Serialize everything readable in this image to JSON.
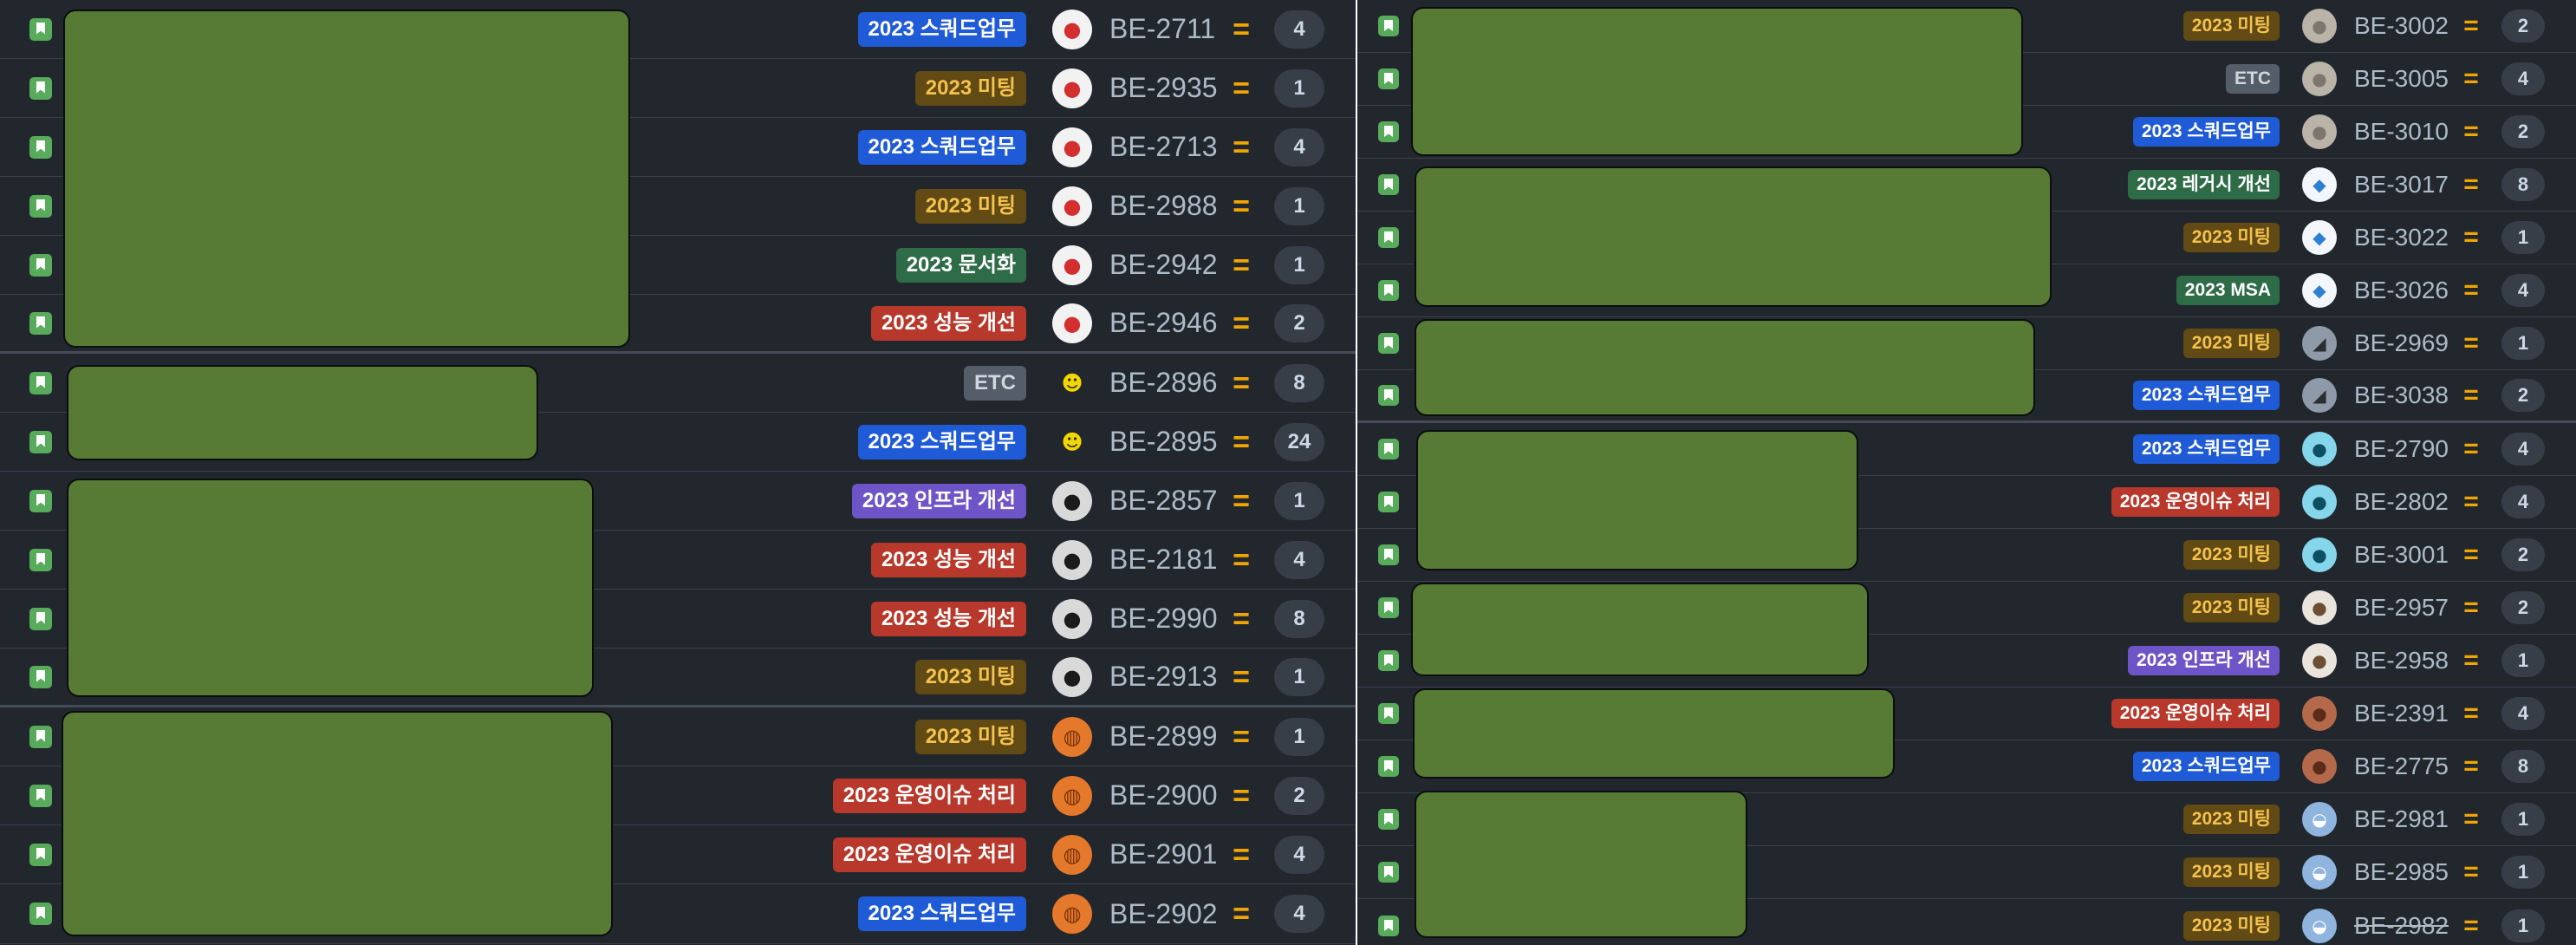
{
  "labels": {
    "squad": {
      "text": "2023 스쿼드업무",
      "bg": "#1f5bd6",
      "fg": "#ffffff"
    },
    "meeting": {
      "text": "2023 미팅",
      "bg": "#614a14",
      "fg": "#f5c24d"
    },
    "docs": {
      "text": "2023 문서화",
      "bg": "#2e6b47",
      "fg": "#ffffff"
    },
    "perf": {
      "text": "2023 성능 개선",
      "bg": "#b8382b",
      "fg": "#ffffff"
    },
    "etc": {
      "text": "ETC",
      "bg": "#545d68",
      "fg": "#d0d7de"
    },
    "infra": {
      "text": "2023 인프라 개선",
      "bg": "#6e55c7",
      "fg": "#ffffff"
    },
    "ops": {
      "text": "2023 운영이슈 처리",
      "bg": "#b8382b",
      "fg": "#ffffff"
    },
    "legacy": {
      "text": "2023 레거시 개선",
      "bg": "#2e6b47",
      "fg": "#ffffff"
    },
    "msa": {
      "text": "2023 MSA",
      "bg": "#2e6b47",
      "fg": "#ffffff"
    }
  },
  "avatars": {
    "snoopy": {
      "icon": "snoopy-avatar-icon",
      "glyph": "●",
      "bg": "#f2f2f2",
      "fg": "#d32f2f"
    },
    "frog": {
      "icon": "frog-avatar-icon",
      "glyph": "☻",
      "bg": "#22272e",
      "fg": "#f2d600"
    },
    "person": {
      "icon": "person-avatar-icon",
      "glyph": "●",
      "bg": "#d9d9d9",
      "fg": "#1b1b1b"
    },
    "ball": {
      "icon": "basketball-avatar-icon",
      "glyph": "◍",
      "bg": "#e4792b",
      "fg": "#7a3206"
    },
    "cat": {
      "icon": "cat-avatar-icon",
      "glyph": "●",
      "bg": "#b9b3a8",
      "fg": "#7d766d"
    },
    "whale": {
      "icon": "whale-avatar-icon",
      "glyph": "◆",
      "bg": "#f3f6fa",
      "fg": "#2f80d1"
    },
    "road": {
      "icon": "road-avatar-icon",
      "glyph": "◢",
      "bg": "#8e9aa8",
      "fg": "#2b2f33"
    },
    "gopher": {
      "icon": "gopher-avatar-icon",
      "glyph": "●",
      "bg": "#85d6ea",
      "fg": "#0d4f63"
    },
    "kitten": {
      "icon": "kitten-avatar-icon",
      "glyph": "●",
      "bg": "#e9e4dc",
      "fg": "#6d4d33"
    },
    "face": {
      "icon": "face-avatar-icon",
      "glyph": "●",
      "bg": "#b46a4a",
      "fg": "#5a2c19"
    },
    "sky": {
      "icon": "sky-avatar-icon",
      "glyph": "◒",
      "bg": "#8fb4de",
      "fg": "#ffffff"
    }
  },
  "left": [
    {
      "label": "squad",
      "avatar": "snoopy",
      "key": "BE-2711",
      "priority": "=",
      "points": "4"
    },
    {
      "label": "meeting",
      "avatar": "snoopy",
      "key": "BE-2935",
      "priority": "=",
      "points": "1"
    },
    {
      "label": "squad",
      "avatar": "snoopy",
      "key": "BE-2713",
      "priority": "=",
      "points": "4"
    },
    {
      "label": "meeting",
      "avatar": "snoopy",
      "key": "BE-2988",
      "priority": "=",
      "points": "1"
    },
    {
      "label": "docs",
      "avatar": "snoopy",
      "key": "BE-2942",
      "priority": "=",
      "points": "1"
    },
    {
      "label": "perf",
      "avatar": "snoopy",
      "key": "BE-2946",
      "priority": "=",
      "points": "2"
    },
    {
      "label": "etc",
      "avatar": "frog",
      "key": "BE-2896",
      "priority": "=",
      "points": "8"
    },
    {
      "label": "squad",
      "avatar": "frog",
      "key": "BE-2895",
      "priority": "=",
      "points": "24"
    },
    {
      "label": "infra",
      "avatar": "person",
      "key": "BE-2857",
      "priority": "=",
      "points": "1"
    },
    {
      "label": "perf",
      "avatar": "person",
      "key": "BE-2181",
      "priority": "=",
      "points": "4"
    },
    {
      "label": "perf",
      "avatar": "person",
      "key": "BE-2990",
      "priority": "=",
      "points": "8"
    },
    {
      "label": "meeting",
      "avatar": "person",
      "key": "BE-2913",
      "priority": "=",
      "points": "1"
    },
    {
      "label": "meeting",
      "avatar": "ball",
      "key": "BE-2899",
      "priority": "=",
      "points": "1"
    },
    {
      "label": "ops",
      "avatar": "ball",
      "key": "BE-2900",
      "priority": "=",
      "points": "2"
    },
    {
      "label": "ops",
      "avatar": "ball",
      "key": "BE-2901",
      "priority": "=",
      "points": "4"
    },
    {
      "label": "squad",
      "avatar": "ball",
      "key": "BE-2902",
      "priority": "=",
      "points": "4"
    }
  ],
  "right": [
    {
      "label": "meeting",
      "avatar": "cat",
      "key": "BE-3002",
      "priority": "=",
      "points": "2"
    },
    {
      "label": "etc",
      "avatar": "cat",
      "key": "BE-3005",
      "priority": "=",
      "points": "4"
    },
    {
      "label": "squad",
      "avatar": "cat",
      "key": "BE-3010",
      "priority": "=",
      "points": "2"
    },
    {
      "label": "legacy",
      "avatar": "whale",
      "key": "BE-3017",
      "priority": "=",
      "points": "8"
    },
    {
      "label": "meeting",
      "avatar": "whale",
      "key": "BE-3022",
      "priority": "=",
      "points": "1"
    },
    {
      "label": "msa",
      "avatar": "whale",
      "key": "BE-3026",
      "priority": "=",
      "points": "4"
    },
    {
      "label": "meeting",
      "avatar": "road",
      "key": "BE-2969",
      "priority": "=",
      "points": "1"
    },
    {
      "label": "squad",
      "avatar": "road",
      "key": "BE-3038",
      "priority": "=",
      "points": "2"
    },
    {
      "label": "squad",
      "avatar": "gopher",
      "key": "BE-2790",
      "priority": "=",
      "points": "4"
    },
    {
      "label": "ops",
      "avatar": "gopher",
      "key": "BE-2802",
      "priority": "=",
      "points": "4"
    },
    {
      "label": "meeting",
      "avatar": "gopher",
      "key": "BE-3001",
      "priority": "=",
      "points": "2"
    },
    {
      "label": "meeting",
      "avatar": "kitten",
      "key": "BE-2957",
      "priority": "=",
      "points": "2"
    },
    {
      "label": "infra",
      "avatar": "kitten",
      "key": "BE-2958",
      "priority": "=",
      "points": "1"
    },
    {
      "label": "ops",
      "avatar": "face",
      "key": "BE-2391",
      "priority": "=",
      "points": "4"
    },
    {
      "label": "squad",
      "avatar": "face",
      "key": "BE-2775",
      "priority": "=",
      "points": "8"
    },
    {
      "label": "meeting",
      "avatar": "sky",
      "key": "BE-2981",
      "priority": "=",
      "points": "1"
    },
    {
      "label": "meeting",
      "avatar": "sky",
      "key": "BE-2985",
      "priority": "=",
      "points": "1"
    },
    {
      "label": "meeting",
      "avatar": "sky",
      "key": "BE-2982",
      "priority": "=",
      "points": "1",
      "done": true
    }
  ]
}
